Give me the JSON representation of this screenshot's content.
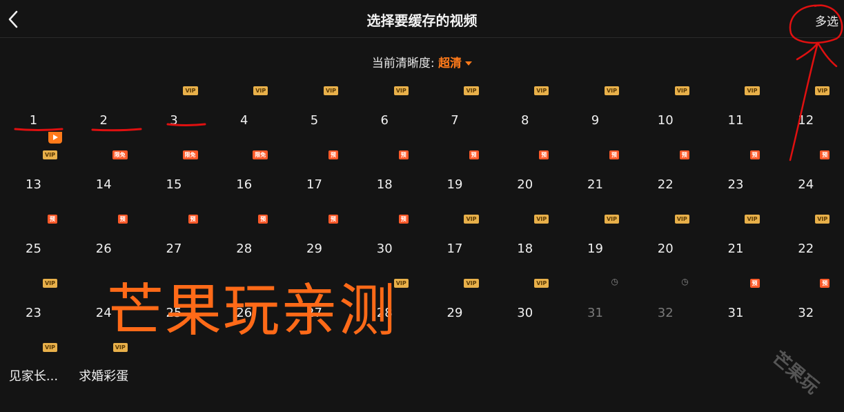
{
  "header": {
    "title": "选择要缓存的视频",
    "multi_select": "多选"
  },
  "quality": {
    "label": "当前清晰度:",
    "value": "超清"
  },
  "colors": {
    "accent": "#ff7a1a",
    "vip": "#e8b04a",
    "preview": "#ff5a2a",
    "annotation": "#e01010"
  },
  "icons": {
    "back": "chevron-left-icon",
    "dropdown": "caret-down-icon",
    "playing": "play-icon",
    "clock": "clock-icon"
  },
  "badge_text": {
    "vip": "VIP",
    "pre": "预",
    "xm": "限免",
    "clock": "◷"
  },
  "episodes": [
    {
      "label": "1",
      "badge": null,
      "playing": true
    },
    {
      "label": "2",
      "badge": null
    },
    {
      "label": "3",
      "badge": "vip"
    },
    {
      "label": "4",
      "badge": "vip"
    },
    {
      "label": "5",
      "badge": "vip"
    },
    {
      "label": "6",
      "badge": "vip"
    },
    {
      "label": "7",
      "badge": "vip"
    },
    {
      "label": "8",
      "badge": "vip"
    },
    {
      "label": "9",
      "badge": "vip"
    },
    {
      "label": "10",
      "badge": "vip"
    },
    {
      "label": "11",
      "badge": "vip"
    },
    {
      "label": "12",
      "badge": "vip"
    },
    {
      "label": "13",
      "badge": "vip"
    },
    {
      "label": "14",
      "badge": "xm"
    },
    {
      "label": "15",
      "badge": "xm"
    },
    {
      "label": "16",
      "badge": "xm"
    },
    {
      "label": "17",
      "badge": "pre"
    },
    {
      "label": "18",
      "badge": "pre"
    },
    {
      "label": "19",
      "badge": "pre"
    },
    {
      "label": "20",
      "badge": "pre"
    },
    {
      "label": "21",
      "badge": "pre"
    },
    {
      "label": "22",
      "badge": "pre"
    },
    {
      "label": "23",
      "badge": "pre"
    },
    {
      "label": "24",
      "badge": "pre"
    },
    {
      "label": "25",
      "badge": "pre"
    },
    {
      "label": "26",
      "badge": "pre"
    },
    {
      "label": "27",
      "badge": "pre"
    },
    {
      "label": "28",
      "badge": "pre"
    },
    {
      "label": "29",
      "badge": "pre"
    },
    {
      "label": "30",
      "badge": "pre"
    },
    {
      "label": "17",
      "badge": "vip"
    },
    {
      "label": "18",
      "badge": "vip"
    },
    {
      "label": "19",
      "badge": "vip"
    },
    {
      "label": "20",
      "badge": "vip"
    },
    {
      "label": "21",
      "badge": "vip"
    },
    {
      "label": "22",
      "badge": "vip"
    },
    {
      "label": "23",
      "badge": "vip"
    },
    {
      "label": "24",
      "badge": null
    },
    {
      "label": "25",
      "badge": null
    },
    {
      "label": "26",
      "badge": null
    },
    {
      "label": "27",
      "badge": null
    },
    {
      "label": "28",
      "badge": "vip"
    },
    {
      "label": "29",
      "badge": "vip"
    },
    {
      "label": "30",
      "badge": "vip"
    },
    {
      "label": "31",
      "badge": "clock",
      "disabled": true
    },
    {
      "label": "32",
      "badge": "clock",
      "disabled": true
    },
    {
      "label": "31",
      "badge": "pre"
    },
    {
      "label": "32",
      "badge": "pre"
    },
    {
      "label": "见家长...",
      "badge": "vip"
    },
    {
      "label": "求婚彩蛋",
      "badge": "vip"
    }
  ],
  "watermark": "芒果玩亲测",
  "corner_watermark": "芒果玩"
}
